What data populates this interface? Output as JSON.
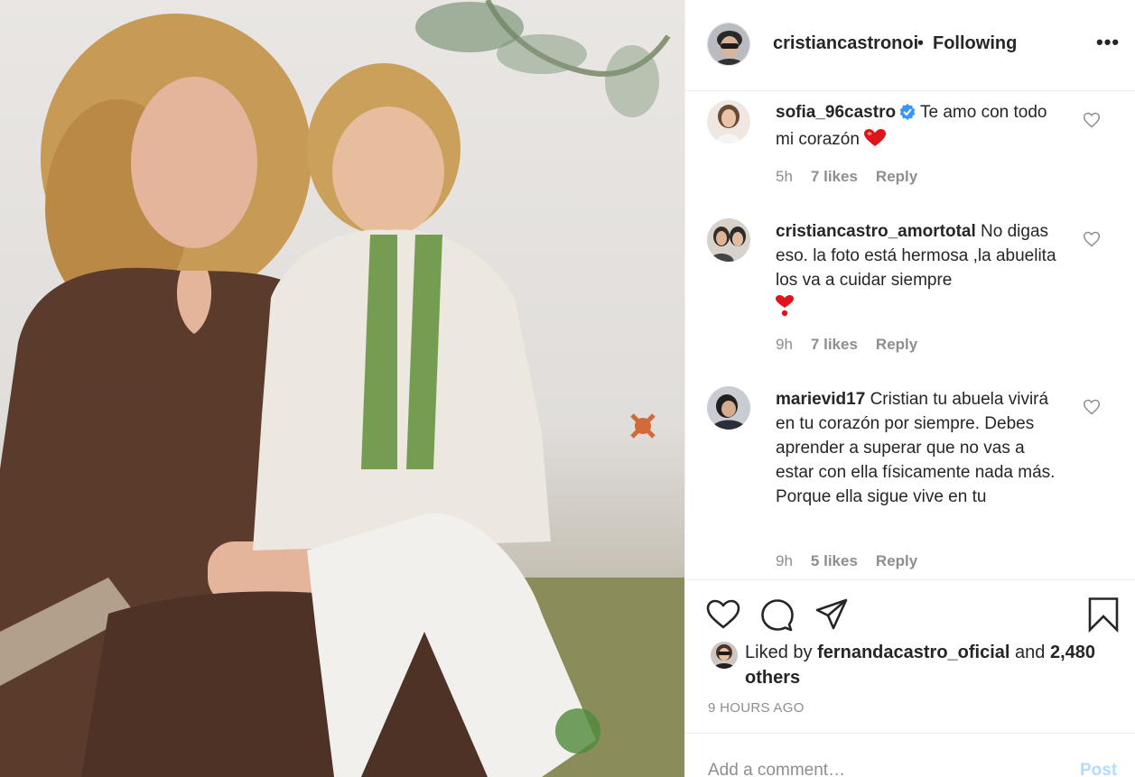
{
  "post": {
    "author": "cristiancastronoi",
    "separator": "•",
    "follow_status": "Following",
    "more_icon": "more-icon",
    "more_label": "•••"
  },
  "comments": [
    {
      "username": "sofia_96castro",
      "verified": true,
      "text": " Te amo con todo mi corazón ",
      "emoji": "heart",
      "time": "5h",
      "likes": "7 likes",
      "reply": "Reply"
    },
    {
      "username": "cristiancastro_amortotal",
      "verified": false,
      "text": " No digas eso. la foto está hermosa ,la abuelita los va a cuidar siempre",
      "emoji": "heart-exclamation",
      "time": "9h",
      "likes": "7 likes",
      "reply": "Reply"
    },
    {
      "username": "marievid17",
      "verified": false,
      "text": " Cristian tu abuela vivirá en tu corazón por siempre. Debes aprender a superar que no vas a estar con ella físicamente nada más. Porque ella sigue vive en tu",
      "time": "9h",
      "likes": "5 likes",
      "reply": "Reply"
    }
  ],
  "liked_by": {
    "prefix": "Liked by ",
    "user": "fernandacastro_oficial",
    "middle": " and ",
    "others": "2,480 others"
  },
  "time_ago": "9 HOURS AGO",
  "add_comment": {
    "placeholder": "Add a comment…",
    "post_label": "Post"
  },
  "colors": {
    "text": "#262626",
    "muted": "#8e8e8e",
    "verified": "#3897f0",
    "heart": "#ed4956",
    "post_disabled": "#b3dbff"
  }
}
